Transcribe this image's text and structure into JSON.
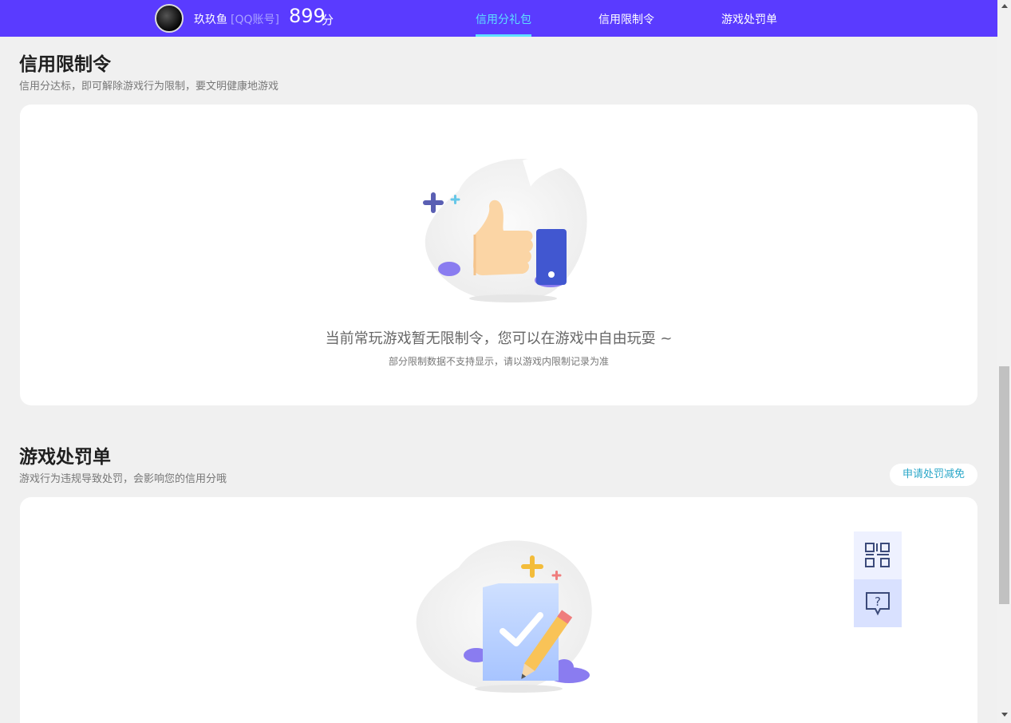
{
  "header": {
    "username": "玖玖鱼",
    "account_type": "[QQ账号]",
    "score": "899",
    "score_unit": "分",
    "tabs": [
      {
        "label": "信用分礼包",
        "active": true
      },
      {
        "label": "信用限制令",
        "active": false
      },
      {
        "label": "游戏处罚单",
        "active": false
      }
    ]
  },
  "restriction": {
    "title": "信用限制令",
    "subtitle": "信用分达标，即可解除游戏行为限制，要文明健康地游戏",
    "empty_main": "当前常玩游戏暂无限制令，您可以在游戏中自由玩耍 ~",
    "empty_sub": "部分限制数据不支持显示，请以游戏内限制记录为准"
  },
  "penalty": {
    "title": "游戏处罚单",
    "subtitle": "游戏行为违规导致处罚，会影响您的信用分哦",
    "apply_button": "申请处罚减免"
  },
  "float_tools": [
    {
      "icon": "qr-code-icon"
    },
    {
      "icon": "help-chat-icon"
    }
  ],
  "colors": {
    "brand": "#5a3bff",
    "active_tab": "#5de0ff",
    "link": "#2aa7c8"
  }
}
